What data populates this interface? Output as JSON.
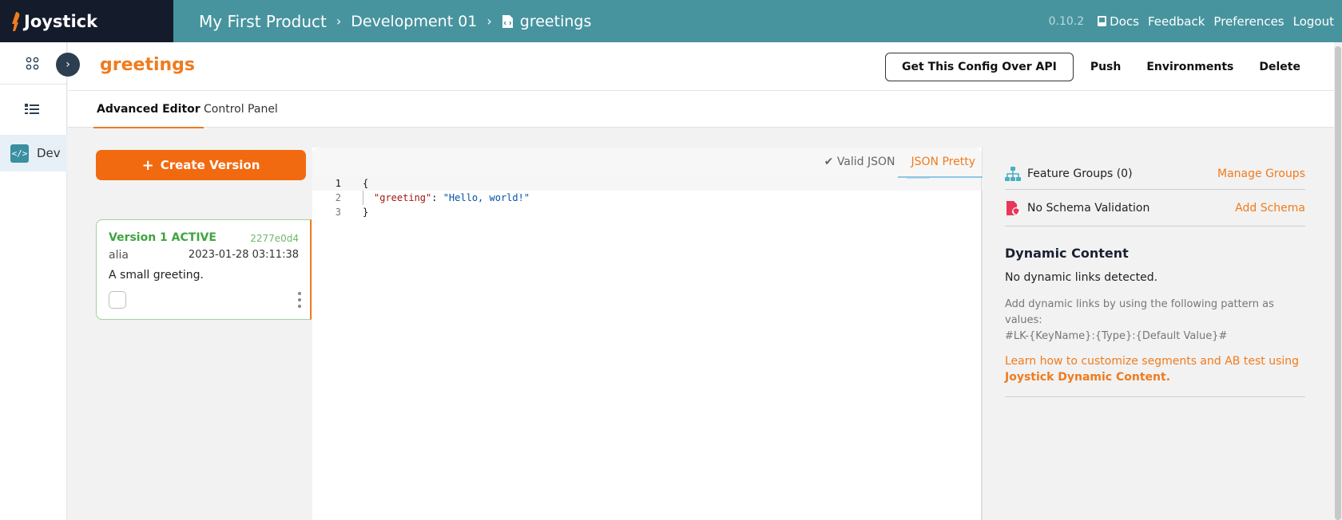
{
  "app": {
    "name": "Joystick",
    "version": "0.10.2"
  },
  "breadcrumb": [
    "My First Product",
    "Development 01",
    "greetings"
  ],
  "topnav": {
    "docs": "Docs",
    "feedback": "Feedback",
    "preferences": "Preferences",
    "logout": "Logout"
  },
  "sidebar": {
    "dev_label": "Dev",
    "dev_icon_text": "</>"
  },
  "page": {
    "title": "greetings",
    "actions": {
      "get_config": "Get This Config Over API",
      "push": "Push",
      "environments": "Environments",
      "delete": "Delete"
    }
  },
  "tabs": [
    "Advanced Editor",
    "Control Panel"
  ],
  "versions": {
    "create_label": "Create Version",
    "items": [
      {
        "title": "Version 1 ACTIVE",
        "hash": "2277e0d4",
        "user": "alia",
        "date": "2023-01-28 03:11:38",
        "description": "A small greeting."
      }
    ]
  },
  "editor": {
    "valid_label": "✔ Valid JSON",
    "pretty_label": "JSON Pretty",
    "lines": [
      {
        "num": "1",
        "open": "{"
      },
      {
        "num": "2",
        "key": "\"greeting\"",
        "colon": ": ",
        "value": "\"Hello, world!\""
      },
      {
        "num": "3",
        "close": "}"
      }
    ]
  },
  "sidepanel": {
    "feature_groups": "Feature Groups (0)",
    "manage_groups": "Manage Groups",
    "schema": "No Schema Validation",
    "add_schema": "Add Schema",
    "dynamic_title": "Dynamic Content",
    "dynamic_none": "No dynamic links detected.",
    "dynamic_help_1": "Add dynamic links by using the following pattern as values:",
    "dynamic_help_2": "#LK-{KeyName}:{Type}:{Default Value}#",
    "dynamic_link_1": "Learn how to customize segments and AB test using",
    "dynamic_link_2": "Joystick Dynamic Content."
  },
  "colors": {
    "header": "#47949f",
    "logo_bg": "#141b2b",
    "accent": "#f07b1d",
    "create_button": "#f26a10",
    "active_green": "#3ea441"
  }
}
